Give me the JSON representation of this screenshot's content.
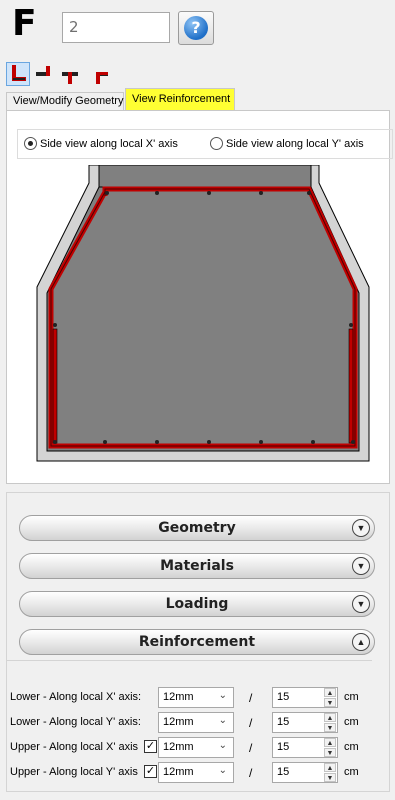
{
  "header": {
    "label": "F",
    "id_value": "2",
    "help_icon": "help-question-icon"
  },
  "joint_types": [
    {
      "name": "joint-type-1-icon",
      "selected": true
    },
    {
      "name": "joint-type-2-icon",
      "selected": false
    },
    {
      "name": "joint-type-3-icon",
      "selected": false
    },
    {
      "name": "joint-type-4-icon",
      "selected": false
    }
  ],
  "tabs": [
    {
      "label": "View/Modify Geometry",
      "active": false
    },
    {
      "label": "View Reinforcement",
      "active": true
    }
  ],
  "view": {
    "option_x": "Side view along local X' axis",
    "option_y": "Side view along local Y' axis",
    "selected": "x"
  },
  "colors": {
    "rebar": "#c00000",
    "concrete": "#808080",
    "cover": "#d4d4d4",
    "outline": "#000000",
    "active_tab": "#ffff33"
  },
  "sections": [
    {
      "label": "Geometry",
      "expanded": false
    },
    {
      "label": "Materials",
      "expanded": false
    },
    {
      "label": "Loading",
      "expanded": false
    },
    {
      "label": "Reinforcement",
      "expanded": true
    }
  ],
  "reinforcement": {
    "unit": "cm",
    "separator": "/",
    "rows": [
      {
        "label": "Lower - Along local X' axis:",
        "has_checkbox": false,
        "checked": false,
        "diameter": "12mm",
        "spacing": "15"
      },
      {
        "label": "Lower - Along local Y' axis:",
        "has_checkbox": false,
        "checked": false,
        "diameter": "12mm",
        "spacing": "15"
      },
      {
        "label": "Upper - Along local X' axis",
        "has_checkbox": true,
        "checked": true,
        "diameter": "12mm",
        "spacing": "15"
      },
      {
        "label": "Upper - Along local Y' axis",
        "has_checkbox": true,
        "checked": true,
        "diameter": "12mm",
        "spacing": "15"
      }
    ]
  }
}
